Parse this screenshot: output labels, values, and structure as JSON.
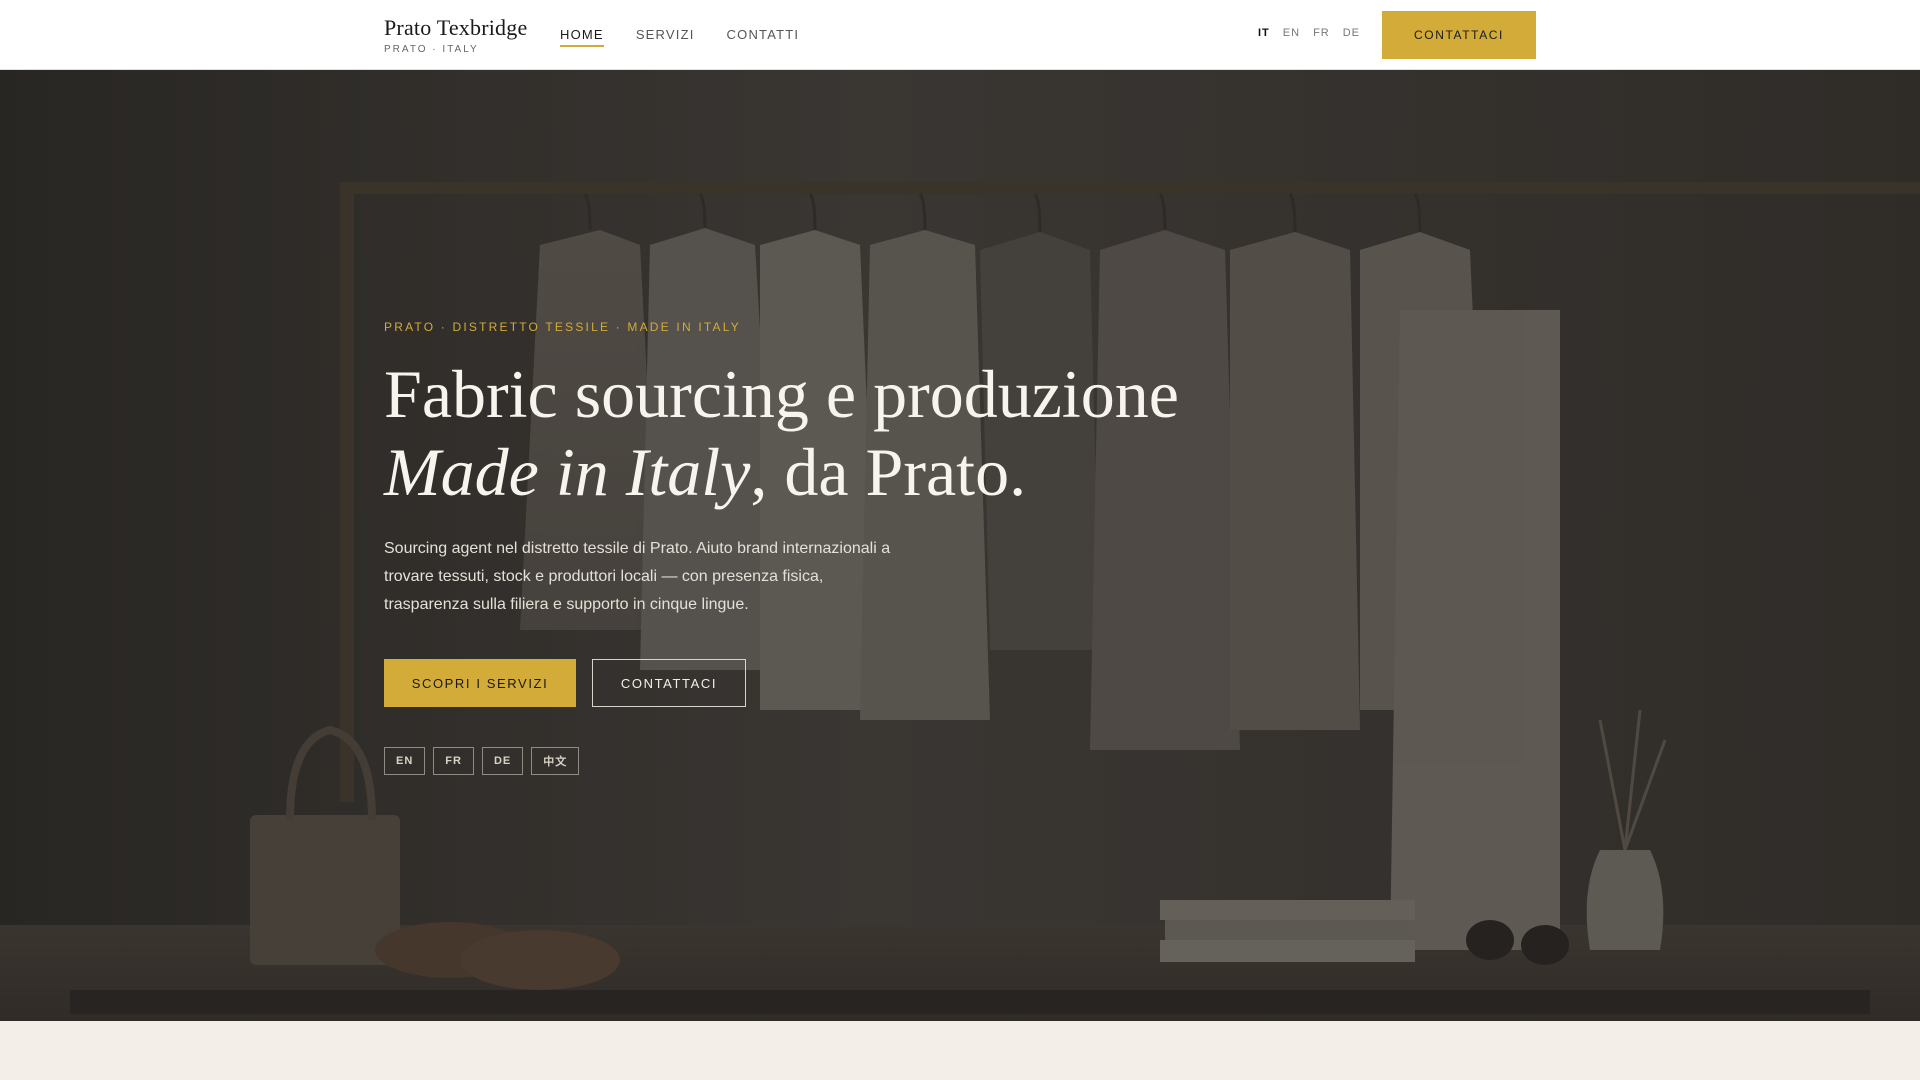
{
  "header": {
    "brand_name": "Prato Texbridge",
    "brand_sub": "PRATO · ITALY",
    "nav": [
      {
        "label": "HOME",
        "active": true
      },
      {
        "label": "SERVIZI",
        "active": false
      },
      {
        "label": "CONTATTI",
        "active": false
      }
    ],
    "languages": [
      {
        "label": "IT",
        "active": true
      },
      {
        "label": "EN",
        "active": false
      },
      {
        "label": "FR",
        "active": false
      },
      {
        "label": "DE",
        "active": false
      }
    ],
    "cta_label": "CONTATTACI"
  },
  "hero": {
    "kicker": "PRATO · DISTRETTO TESSILE · MADE IN ITALY",
    "headline_line1": "Fabric sourcing e produzione",
    "headline_italic": "Made in Italy",
    "headline_rest": ", da Prato.",
    "lead": "Sourcing agent nel distretto tessile di Prato. Aiuto brand internazionali a trovare tessuti, stock e produttori locali — con presenza fisica, trasparenza sulla filiera e supporto in cinque lingue.",
    "primary_button": "SCOPRI I SERVIZI",
    "secondary_button": "CONTATTACI",
    "language_chips": [
      "EN",
      "FR",
      "DE",
      "中文"
    ]
  },
  "colors": {
    "accent": "#d2ab38",
    "hero_text": "#f7f4ee",
    "page_bg": "#f3efe8"
  }
}
